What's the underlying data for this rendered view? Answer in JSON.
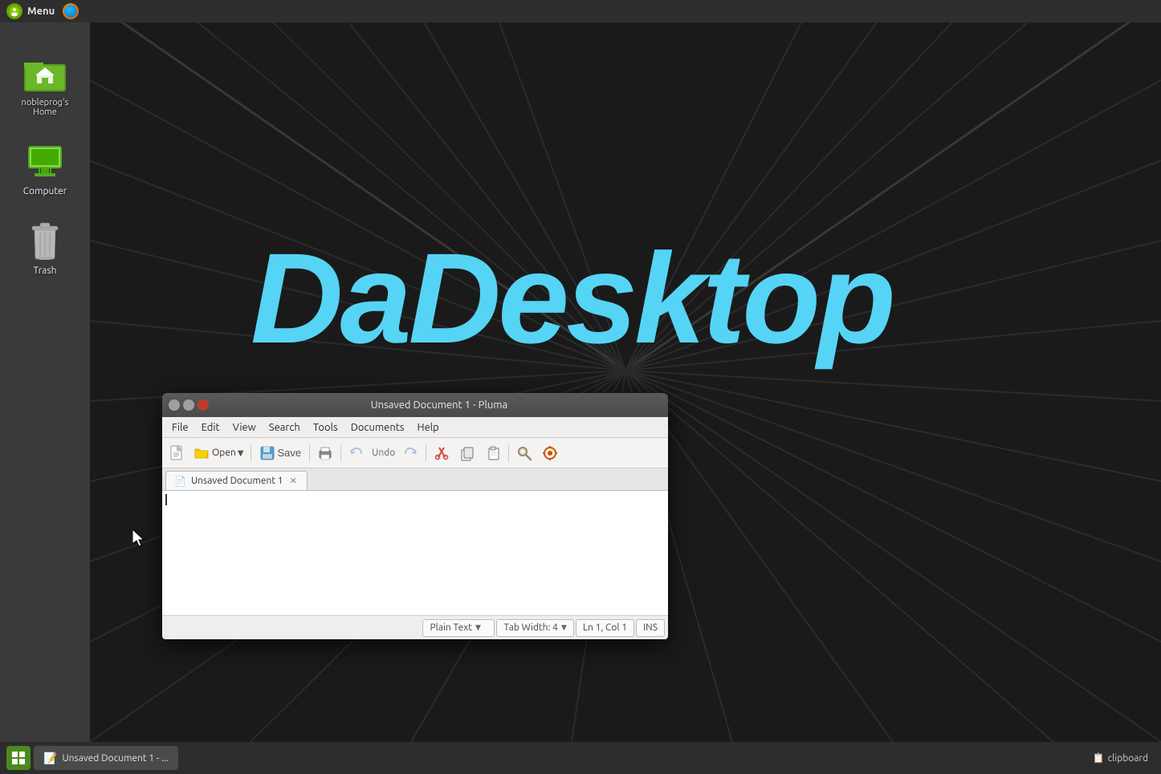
{
  "topbar": {
    "menu_label": "Menu",
    "logo_text": "●"
  },
  "desktop": {
    "title": "DaDesktop",
    "icons": [
      {
        "id": "home",
        "label": "nobleprog's Home"
      },
      {
        "id": "computer",
        "label": "Computer"
      },
      {
        "id": "trash",
        "label": "Trash"
      }
    ]
  },
  "pluma": {
    "title": "Unsaved Document 1 - Pluma",
    "menu_items": [
      "File",
      "Edit",
      "View",
      "Search",
      "Tools",
      "Documents",
      "Help"
    ],
    "tab_label": "Unsaved Document 1",
    "status": {
      "language": "Plain Text",
      "tab_width": "Tab Width:  4",
      "position": "Ln 1, Col 1",
      "mode": "INS"
    }
  },
  "taskbar": {
    "window_label": "Unsaved Document 1 - ...",
    "clipboard_label": "clipboard"
  }
}
